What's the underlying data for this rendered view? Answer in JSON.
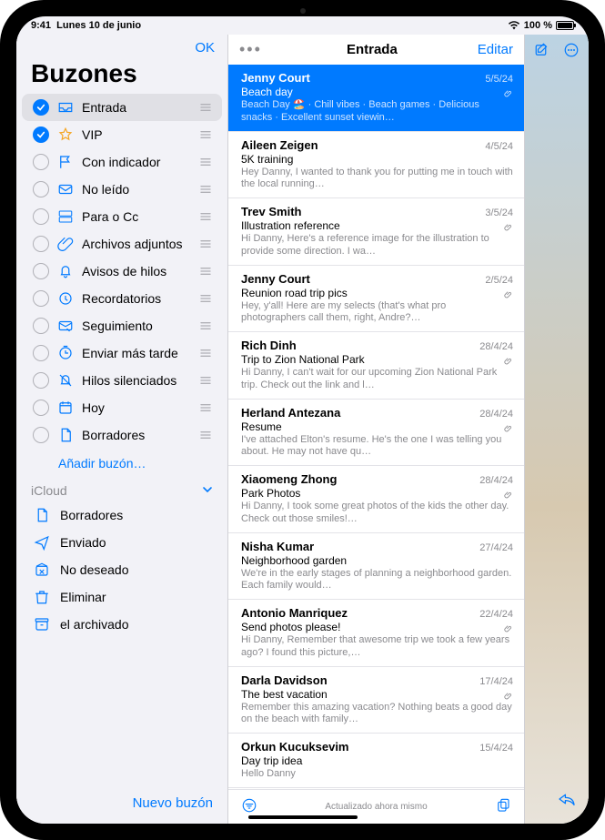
{
  "status": {
    "time": "9:41",
    "date": "Lunes 10 de junio",
    "battery_pct": "100 %"
  },
  "sidebar": {
    "ok": "OK",
    "title": "Buzones",
    "items": [
      {
        "label": "Entrada",
        "checked": true,
        "icon": "inbox"
      },
      {
        "label": "VIP",
        "checked": true,
        "icon": "star"
      },
      {
        "label": "Con indicador",
        "checked": false,
        "icon": "flag"
      },
      {
        "label": "No leído",
        "checked": false,
        "icon": "mail"
      },
      {
        "label": "Para o Cc",
        "checked": false,
        "icon": "tocc"
      },
      {
        "label": "Archivos adjuntos",
        "checked": false,
        "icon": "clip"
      },
      {
        "label": "Avisos de hilos",
        "checked": false,
        "icon": "bell"
      },
      {
        "label": "Recordatorios",
        "checked": false,
        "icon": "clock"
      },
      {
        "label": "Seguimiento",
        "checked": false,
        "icon": "followup"
      },
      {
        "label": "Enviar más tarde",
        "checked": false,
        "icon": "sendlater"
      },
      {
        "label": "Hilos silenciados",
        "checked": false,
        "icon": "mute"
      },
      {
        "label": "Hoy",
        "checked": false,
        "icon": "today"
      },
      {
        "label": "Borradores",
        "checked": false,
        "icon": "doc"
      }
    ],
    "add_label": "Añadir buzón…",
    "account": {
      "name": "iCloud",
      "folders": [
        {
          "label": "Borradores",
          "icon": "doc"
        },
        {
          "label": "Enviado",
          "icon": "sent"
        },
        {
          "label": "No deseado",
          "icon": "junk"
        },
        {
          "label": "Eliminar",
          "icon": "trash"
        },
        {
          "label": "el archivado",
          "icon": "archive"
        }
      ]
    },
    "new_mailbox": "Nuevo buzón"
  },
  "list": {
    "title": "Entrada",
    "edit": "Editar",
    "status": "Actualizado ahora mismo",
    "messages": [
      {
        "sender": "Jenny Court",
        "date": "5/5/24",
        "subject": "Beach day",
        "preview": "Beach Day 🏖️ · Chill vibes · Beach games · Delicious snacks · Excellent sunset viewin…",
        "attachment": true,
        "selected": true
      },
      {
        "sender": "Aileen Zeigen",
        "date": "4/5/24",
        "subject": "5K training",
        "preview": "Hey Danny, I wanted to thank you for putting me in touch with the local running…",
        "attachment": false
      },
      {
        "sender": "Trev Smith",
        "date": "3/5/24",
        "subject": "Illustration reference",
        "preview": "Hi Danny, Here's a reference image for the illustration to provide some direction. I wa…",
        "attachment": true
      },
      {
        "sender": "Jenny Court",
        "date": "2/5/24",
        "subject": "Reunion road trip pics",
        "preview": "Hey, y'all! Here are my selects (that's what pro photographers call them, right, Andre?…",
        "attachment": true
      },
      {
        "sender": "Rich Dinh",
        "date": "28/4/24",
        "subject": "Trip to Zion National Park",
        "preview": "Hi Danny, I can't wait for our upcoming Zion National Park trip. Check out the link and l…",
        "attachment": true
      },
      {
        "sender": "Herland Antezana",
        "date": "28/4/24",
        "subject": "Resume",
        "preview": "I've attached Elton's resume. He's the one I was telling you about. He may not have qu…",
        "attachment": true
      },
      {
        "sender": "Xiaomeng Zhong",
        "date": "28/4/24",
        "subject": "Park Photos",
        "preview": "Hi Danny, I took some great photos of the kids the other day. Check out those smiles!…",
        "attachment": true
      },
      {
        "sender": "Nisha Kumar",
        "date": "27/4/24",
        "subject": "Neighborhood garden",
        "preview": "We're in the early stages of planning a neighborhood garden. Each family would…",
        "attachment": false
      },
      {
        "sender": "Antonio Manriquez",
        "date": "22/4/24",
        "subject": "Send photos please!",
        "preview": "Hi Danny, Remember that awesome trip we took a few years ago? I found this picture,…",
        "attachment": true
      },
      {
        "sender": "Darla Davidson",
        "date": "17/4/24",
        "subject": "The best vacation",
        "preview": "Remember this amazing vacation? Nothing beats a good day on the beach with family…",
        "attachment": true
      },
      {
        "sender": "Orkun Kucuksevim",
        "date": "15/4/24",
        "subject": "Day trip idea",
        "preview": "Hello Danny",
        "attachment": false
      }
    ]
  }
}
